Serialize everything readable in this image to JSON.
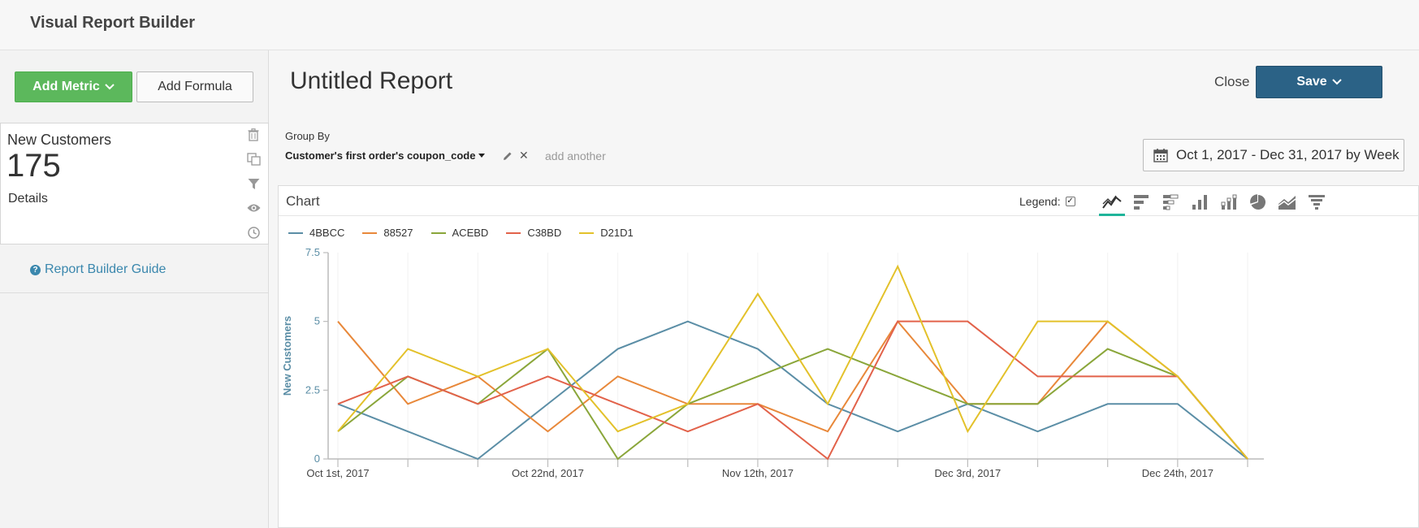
{
  "app": {
    "title": "Visual Report Builder"
  },
  "sidebar": {
    "add_metric_label": "Add Metric",
    "add_formula_label": "Add Formula",
    "metric": {
      "name": "New Customers",
      "value": "175",
      "details_label": "Details"
    },
    "guide_label": "Report Builder Guide"
  },
  "report": {
    "title": "Untitled Report",
    "close_label": "Close",
    "save_label": "Save",
    "group_by_label": "Group By",
    "group_by_value": "Customer's first order's coupon_code",
    "add_another_label": "add another",
    "date_range": "Oct 1, 2017 - Dec 31, 2017 by Week"
  },
  "chart_panel": {
    "title": "Chart",
    "legend_label": "Legend:",
    "legend_checked": true,
    "chart_type_icons": [
      "line-chart-icon",
      "horizontal-bar-icon",
      "stacked-horizontal-bar-icon",
      "bar-chart-icon",
      "stacked-bar-icon",
      "pie-chart-icon",
      "area-chart-icon",
      "funnel-chart-icon"
    ],
    "active_chart_type": "line-chart-icon"
  },
  "chart_data": {
    "type": "line",
    "ylabel": "New Customers",
    "xlabel": "",
    "ylim": [
      0,
      7.5
    ],
    "y_ticks": [
      "0",
      "2.5",
      "5",
      "7.5"
    ],
    "x": [
      "Oct 1st, 2017",
      "Oct 8th, 2017",
      "Oct 15th, 2017",
      "Oct 22nd, 2017",
      "Oct 29th, 2017",
      "Nov 5th, 2017",
      "Nov 12th, 2017",
      "Nov 19th, 2017",
      "Nov 26th, 2017",
      "Dec 3rd, 2017",
      "Dec 10th, 2017",
      "Dec 17th, 2017",
      "Dec 24th, 2017",
      "Dec 31st, 2017"
    ],
    "x_tick_labels": [
      "Oct 1st, 2017",
      "Oct 22nd, 2017",
      "Nov 12th, 2017",
      "Dec 3rd, 2017",
      "Dec 24th, 2017"
    ],
    "x_tick_label_indices": [
      0,
      3,
      6,
      9,
      12
    ],
    "legend_position": "top-left",
    "series": [
      {
        "name": "4BBCC",
        "color": "#5b8ea6",
        "values": [
          2,
          1,
          0,
          2,
          4,
          5,
          4,
          2,
          1,
          2,
          1,
          2,
          2,
          0
        ]
      },
      {
        "name": "88527",
        "color": "#e8883a",
        "values": [
          5,
          2,
          3,
          1,
          3,
          2,
          2,
          1,
          5,
          2,
          2,
          5,
          3,
          0
        ]
      },
      {
        "name": "ACEBD",
        "color": "#8aa63a",
        "values": [
          1,
          3,
          2,
          4,
          0,
          2,
          3,
          4,
          3,
          2,
          2,
          4,
          3,
          0
        ]
      },
      {
        "name": "C38BD",
        "color": "#e2624a",
        "values": [
          2,
          3,
          2,
          3,
          2,
          1,
          2,
          0,
          5,
          5,
          3,
          3,
          3,
          0
        ]
      },
      {
        "name": "D21D1",
        "color": "#e3c12a",
        "values": [
          1,
          4,
          3,
          4,
          1,
          2,
          6,
          2,
          7,
          1,
          5,
          5,
          3,
          0
        ]
      }
    ]
  }
}
